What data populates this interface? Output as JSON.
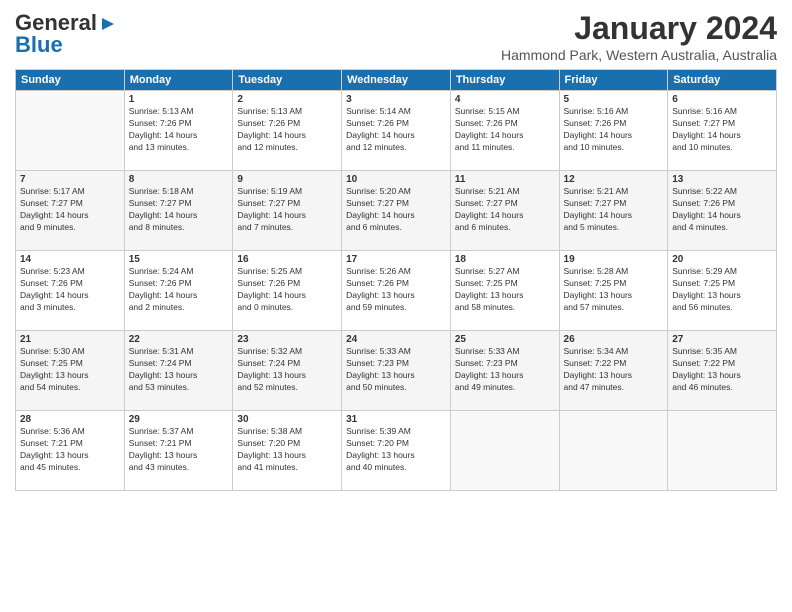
{
  "logo": {
    "line1": "General",
    "line2": "Blue"
  },
  "title": "January 2024",
  "subtitle": "Hammond Park, Western Australia, Australia",
  "days_of_week": [
    "Sunday",
    "Monday",
    "Tuesday",
    "Wednesday",
    "Thursday",
    "Friday",
    "Saturday"
  ],
  "weeks": [
    [
      {
        "day": "",
        "content": ""
      },
      {
        "day": "1",
        "content": "Sunrise: 5:13 AM\nSunset: 7:26 PM\nDaylight: 14 hours\nand 13 minutes."
      },
      {
        "day": "2",
        "content": "Sunrise: 5:13 AM\nSunset: 7:26 PM\nDaylight: 14 hours\nand 12 minutes."
      },
      {
        "day": "3",
        "content": "Sunrise: 5:14 AM\nSunset: 7:26 PM\nDaylight: 14 hours\nand 12 minutes."
      },
      {
        "day": "4",
        "content": "Sunrise: 5:15 AM\nSunset: 7:26 PM\nDaylight: 14 hours\nand 11 minutes."
      },
      {
        "day": "5",
        "content": "Sunrise: 5:16 AM\nSunset: 7:26 PM\nDaylight: 14 hours\nand 10 minutes."
      },
      {
        "day": "6",
        "content": "Sunrise: 5:16 AM\nSunset: 7:27 PM\nDaylight: 14 hours\nand 10 minutes."
      }
    ],
    [
      {
        "day": "7",
        "content": "Sunrise: 5:17 AM\nSunset: 7:27 PM\nDaylight: 14 hours\nand 9 minutes."
      },
      {
        "day": "8",
        "content": "Sunrise: 5:18 AM\nSunset: 7:27 PM\nDaylight: 14 hours\nand 8 minutes."
      },
      {
        "day": "9",
        "content": "Sunrise: 5:19 AM\nSunset: 7:27 PM\nDaylight: 14 hours\nand 7 minutes."
      },
      {
        "day": "10",
        "content": "Sunrise: 5:20 AM\nSunset: 7:27 PM\nDaylight: 14 hours\nand 6 minutes."
      },
      {
        "day": "11",
        "content": "Sunrise: 5:21 AM\nSunset: 7:27 PM\nDaylight: 14 hours\nand 6 minutes."
      },
      {
        "day": "12",
        "content": "Sunrise: 5:21 AM\nSunset: 7:27 PM\nDaylight: 14 hours\nand 5 minutes."
      },
      {
        "day": "13",
        "content": "Sunrise: 5:22 AM\nSunset: 7:26 PM\nDaylight: 14 hours\nand 4 minutes."
      }
    ],
    [
      {
        "day": "14",
        "content": "Sunrise: 5:23 AM\nSunset: 7:26 PM\nDaylight: 14 hours\nand 3 minutes."
      },
      {
        "day": "15",
        "content": "Sunrise: 5:24 AM\nSunset: 7:26 PM\nDaylight: 14 hours\nand 2 minutes."
      },
      {
        "day": "16",
        "content": "Sunrise: 5:25 AM\nSunset: 7:26 PM\nDaylight: 14 hours\nand 0 minutes."
      },
      {
        "day": "17",
        "content": "Sunrise: 5:26 AM\nSunset: 7:26 PM\nDaylight: 13 hours\nand 59 minutes."
      },
      {
        "day": "18",
        "content": "Sunrise: 5:27 AM\nSunset: 7:25 PM\nDaylight: 13 hours\nand 58 minutes."
      },
      {
        "day": "19",
        "content": "Sunrise: 5:28 AM\nSunset: 7:25 PM\nDaylight: 13 hours\nand 57 minutes."
      },
      {
        "day": "20",
        "content": "Sunrise: 5:29 AM\nSunset: 7:25 PM\nDaylight: 13 hours\nand 56 minutes."
      }
    ],
    [
      {
        "day": "21",
        "content": "Sunrise: 5:30 AM\nSunset: 7:25 PM\nDaylight: 13 hours\nand 54 minutes."
      },
      {
        "day": "22",
        "content": "Sunrise: 5:31 AM\nSunset: 7:24 PM\nDaylight: 13 hours\nand 53 minutes."
      },
      {
        "day": "23",
        "content": "Sunrise: 5:32 AM\nSunset: 7:24 PM\nDaylight: 13 hours\nand 52 minutes."
      },
      {
        "day": "24",
        "content": "Sunrise: 5:33 AM\nSunset: 7:23 PM\nDaylight: 13 hours\nand 50 minutes."
      },
      {
        "day": "25",
        "content": "Sunrise: 5:33 AM\nSunset: 7:23 PM\nDaylight: 13 hours\nand 49 minutes."
      },
      {
        "day": "26",
        "content": "Sunrise: 5:34 AM\nSunset: 7:22 PM\nDaylight: 13 hours\nand 47 minutes."
      },
      {
        "day": "27",
        "content": "Sunrise: 5:35 AM\nSunset: 7:22 PM\nDaylight: 13 hours\nand 46 minutes."
      }
    ],
    [
      {
        "day": "28",
        "content": "Sunrise: 5:36 AM\nSunset: 7:21 PM\nDaylight: 13 hours\nand 45 minutes."
      },
      {
        "day": "29",
        "content": "Sunrise: 5:37 AM\nSunset: 7:21 PM\nDaylight: 13 hours\nand 43 minutes."
      },
      {
        "day": "30",
        "content": "Sunrise: 5:38 AM\nSunset: 7:20 PM\nDaylight: 13 hours\nand 41 minutes."
      },
      {
        "day": "31",
        "content": "Sunrise: 5:39 AM\nSunset: 7:20 PM\nDaylight: 13 hours\nand 40 minutes."
      },
      {
        "day": "",
        "content": ""
      },
      {
        "day": "",
        "content": ""
      },
      {
        "day": "",
        "content": ""
      }
    ]
  ]
}
